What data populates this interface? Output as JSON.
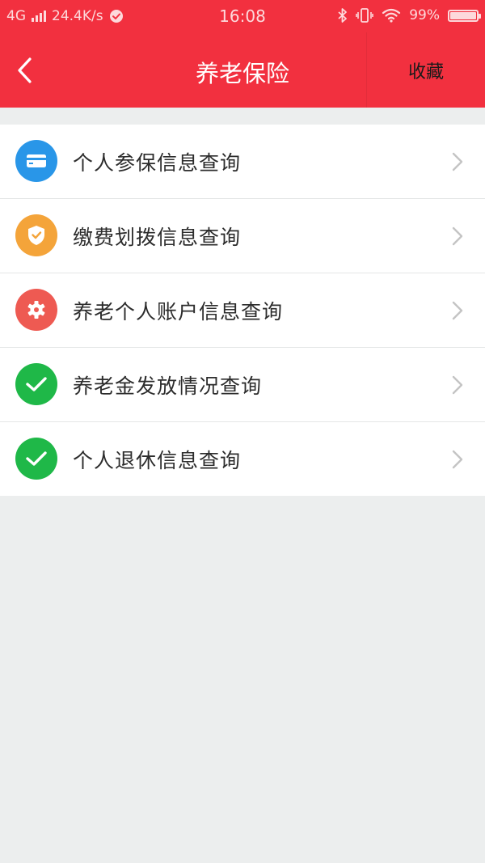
{
  "status_bar": {
    "network": "4G",
    "speed": "24.4K/s",
    "time": "16:08",
    "battery": "99%",
    "battery_level": 0.99
  },
  "nav": {
    "title": "养老保险",
    "favorite_label": "收藏"
  },
  "colors": {
    "header": "#f2303f",
    "blue": "#2996e8",
    "orange": "#f4a43a",
    "red": "#ee5a52",
    "green": "#1fb848"
  },
  "items": [
    {
      "label": "个人参保信息查询",
      "icon": "card-icon",
      "color": "#2996e8"
    },
    {
      "label": "缴费划拨信息查询",
      "icon": "shield-check-icon",
      "color": "#f4a43a"
    },
    {
      "label": "养老个人账户信息查询",
      "icon": "gear-icon",
      "color": "#ee5a52"
    },
    {
      "label": "养老金发放情况查询",
      "icon": "check-icon",
      "color": "#1fb848"
    },
    {
      "label": "个人退休信息查询",
      "icon": "check-icon",
      "color": "#1fb848"
    }
  ]
}
